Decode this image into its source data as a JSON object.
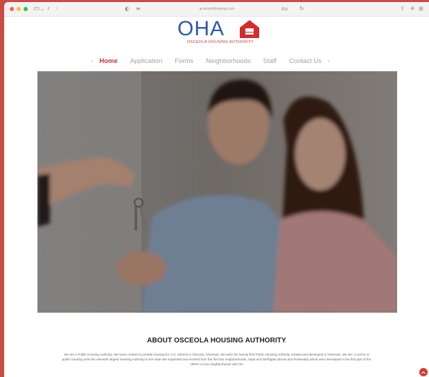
{
  "browser": {
    "address": "osceolahousing.com",
    "traffic_lights": [
      "#fe5f57",
      "#febc2e",
      "#28c840"
    ]
  },
  "logo": {
    "text": "OHA",
    "subtitle": "OSCEOLA HOUSING AUTHORITY",
    "colors": {
      "text": "#2f56a8",
      "house": "#d42b2b",
      "subtitle": "#c4322e"
    }
  },
  "nav": {
    "items": [
      {
        "label": "Home",
        "active": true
      },
      {
        "label": "Application",
        "active": false
      },
      {
        "label": "Forms",
        "active": false
      },
      {
        "label": "Neighborhoods",
        "active": false
      },
      {
        "label": "Staff",
        "active": false
      },
      {
        "label": "Contact Us",
        "active": false
      }
    ],
    "accent": "#c7322d"
  },
  "hero": {
    "alt": "couple receiving house keys"
  },
  "about": {
    "title": "ABOUT OSCEOLA HOUSING AUTHORITY",
    "body": "We are a Public Housing Authority. We were created to provide housing for U.S. citizens in Osceola, Arkansas. We were the twenty-first Public Housing Authority created and developed in Arkansas. We are, in terms of public housing units the eleventh largest Housing Authority in the state We expanded and evolved from the first two neighborhoods, Hyatt and Northgate (Bruns and Rosewald) which were developed in the first part of the 1900's to four neighborhoods with the"
  }
}
